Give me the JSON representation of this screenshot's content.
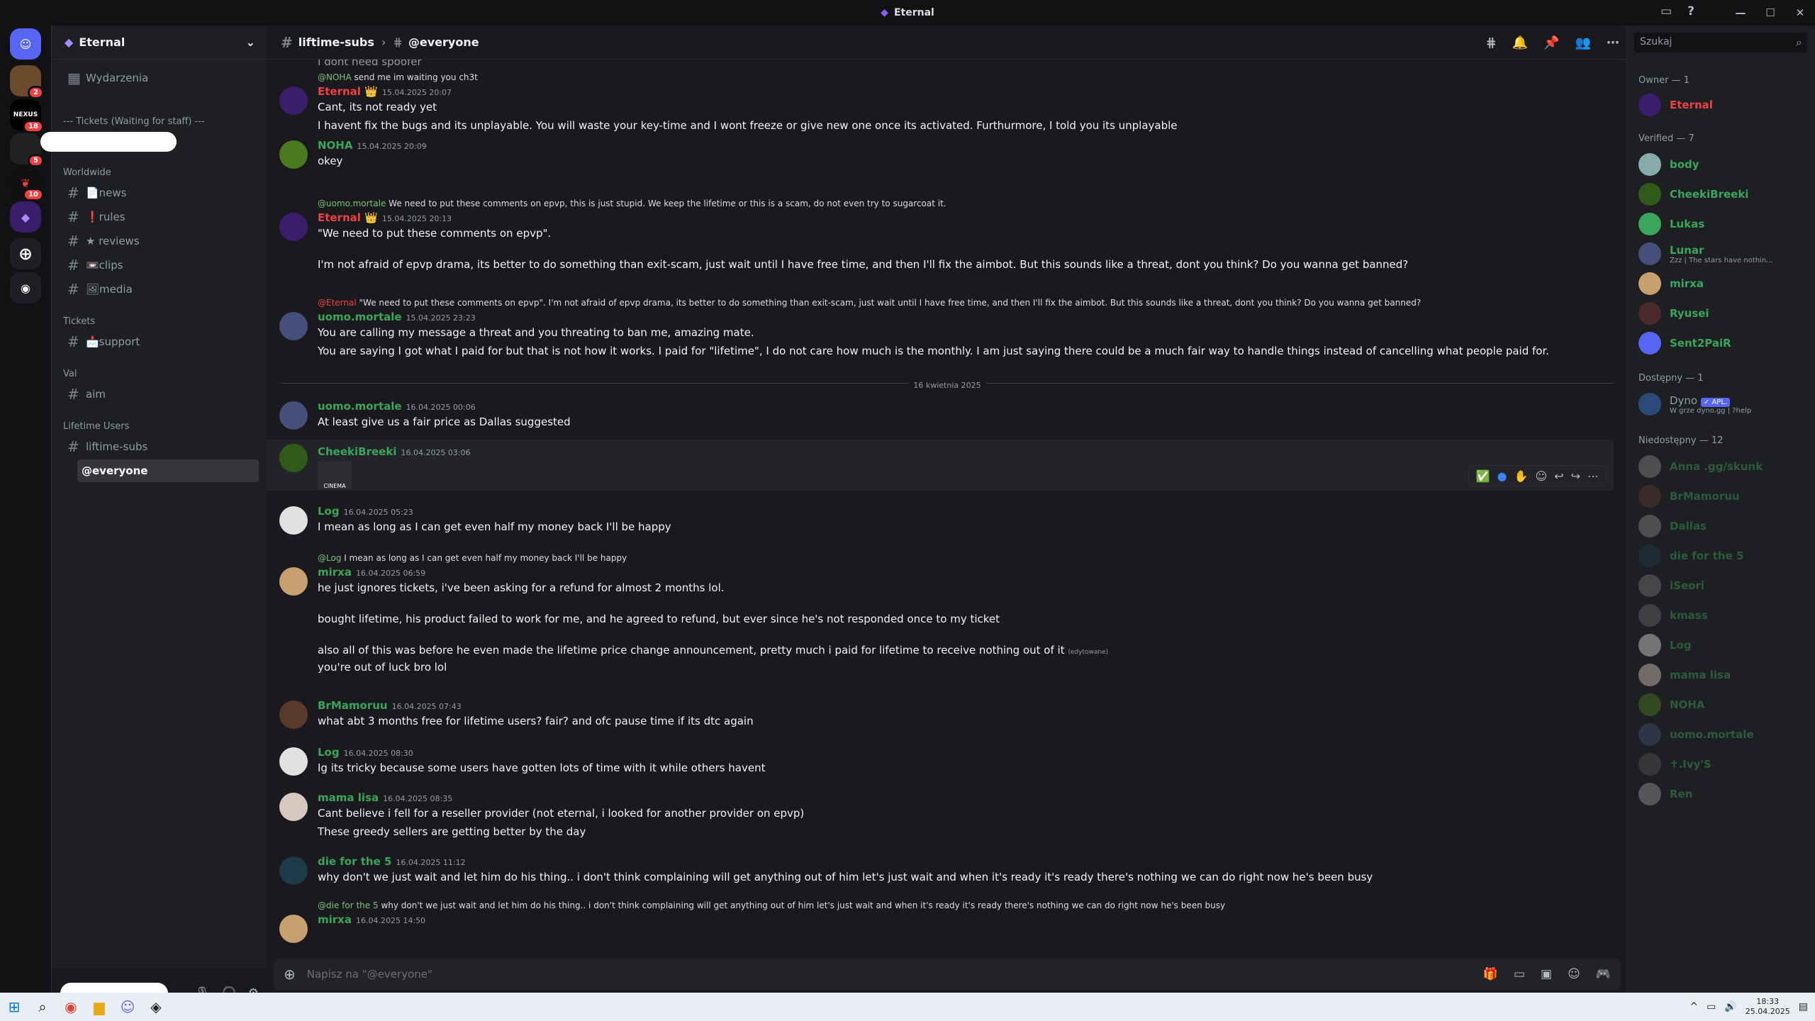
{
  "window": {
    "title": "Eternal",
    "controls": [
      "—",
      "☐",
      "✕"
    ],
    "tray_icons": [
      "▭",
      "?"
    ]
  },
  "server": {
    "name": "Eternal",
    "events": "Wydarzenia",
    "categories": [
      {
        "label": "--- Tickets (Waiting for staff) ---"
      },
      {
        "label": "Worldwide"
      },
      {
        "label": "Tickets"
      },
      {
        "label": "Val"
      },
      {
        "label": "Lifetime Users"
      }
    ],
    "channels": [
      {
        "label": "📄news"
      },
      {
        "label": "❗rules"
      },
      {
        "label": "★ reviews"
      },
      {
        "label": "📼clips"
      },
      {
        "label": "🖼media"
      },
      {
        "label": "📩support"
      },
      {
        "label": "aim"
      },
      {
        "label": "liftime-subs"
      },
      {
        "label": "@everyone"
      }
    ]
  },
  "server_badges": [
    "2",
    "18",
    "5",
    "10"
  ],
  "server_labels": {
    "nexus": "NEXUS"
  },
  "header": {
    "channel": "liftime-subs",
    "thread": "@everyone"
  },
  "colors": {
    "green": "#43b581",
    "red": "#f04747",
    "accent": "#5865f2",
    "name_red": "#ed4245",
    "name_green": "#3ba55c"
  },
  "messages": [
    {
      "reply": "@NOHA",
      "reply_text": "send me im waiting you ch3t",
      "name": "Eternal",
      "time": "15.04.2025 20:07",
      "lines": [
        "Cant, its not ready yet",
        "I havent fix the bugs and its unplayable. You will waste your key-time and I wont freeze or give new one once its activated. Furthurmore, I told you its unplayable"
      ]
    },
    {
      "name": "NOHA",
      "time": "15.04.2025 20:09",
      "lines": [
        "okey"
      ]
    },
    {
      "reply": "@uomo.mortale",
      "reply_text": "We need to put these comments on epvp, this is just stupid. We keep the lifetime or this is a scam, do not even try to sugarcoat it.",
      "name": "Eternal",
      "time": "15.04.2025 20:13",
      "lines": [
        "\"We need to put these comments on epvp\".",
        "I'm not afraid of epvp drama, its better to do something than exit-scam, just wait until I have free time, and then I'll fix the aimbot. But this sounds like a threat, dont you think? Do you wanna get banned?"
      ]
    },
    {
      "reply": "@Eternal",
      "reply_text": "\"We need to put these comments on epvp\".  I'm not afraid of epvp drama, its better to do something than exit-scam, just wait until I have free time, and then I'll fix the aimbot. But this sounds like a threat, dont you think? Do you wanna get banned?",
      "name": "uomo.mortale",
      "time": "15.04.2025 23:23",
      "lines": [
        "You are calling my message a threat and you threating to ban me, amazing mate.",
        "You are saying I got what I paid for but that is not how it works. I paid for \"lifetime\", I do not care how much is the monthly. I am just saying there could be a much fair way to handle things instead of cancelling what people paid for."
      ]
    },
    {
      "name": "uomo.mortale",
      "time": "16.04.2025 00:06",
      "lines": [
        "At least give us a fair price as Dallas suggested"
      ]
    },
    {
      "name": "CheekiBreeki",
      "time": "16.04.2025 03:06",
      "lines": [],
      "image_label": "CINEMA"
    },
    {
      "name": "Log",
      "time": "16.04.2025 05:23",
      "lines": [
        "I mean as long as I can get even half my money back I'll be happy"
      ]
    },
    {
      "reply": "@Log",
      "reply_text": "I mean as long as I can get even half my money back I'll be happy",
      "name": "mirxa",
      "time": "16.04.2025 06:59",
      "lines": [
        "he just ignores tickets, i've been asking for a refund for almost 2 months lol.",
        "bought lifetime, his product failed to work for me, and he agreed to refund, but ever since he's not responded once to my ticket",
        "also all of this was before he even made the lifetime price change announcement, pretty much i paid for lifetime to receive nothing out of it",
        "you're out of luck bro lol"
      ],
      "edited": "(edytowane)"
    },
    {
      "name": "BrMamoruu",
      "time": "16.04.2025 07:43",
      "lines": [
        "what abt 3 months free for lifetime users? fair? and ofc pause time if its dtc again"
      ]
    },
    {
      "name": "Log",
      "time": "16.04.2025 08:30",
      "lines": [
        "Ig its tricky because some users have gotten lots of time with it while others havent"
      ]
    },
    {
      "name": "mama lisa",
      "time": "16.04.2025 08:35",
      "lines": [
        "Cant believe i fell for a reseller provider (not eternal, i looked for another provider on epvp)",
        "These greedy sellers are getting better by the day"
      ]
    },
    {
      "name": "die for the 5",
      "time": "16.04.2025 11:12",
      "lines": [
        "why don't we just wait and let him do his thing.. i don't think complaining will get anything out of him let's just wait and when it's ready it's ready there's nothing we can do right now he's been busy"
      ]
    },
    {
      "reply": "@die for the 5",
      "reply_text": "why don't we just wait and let him do his thing.. i don't think complaining will get anything out of him let's just wait and when it's ready it's ready there's nothing we can do right now he's been busy",
      "name": "mirxa",
      "time": "16.04.2025 14:50",
      "lines": []
    }
  ],
  "top_partial": "I dont need spoofer",
  "date_divider": "16 kwietnia 2025",
  "composer": {
    "placeholder": "Napisz na \"@everyone\""
  },
  "members": {
    "search": "Szukaj",
    "groups": [
      {
        "label": "Owner — 1"
      },
      {
        "label": "Verified — 7"
      },
      {
        "label": "Dostępny — 1"
      },
      {
        "label": "Niedostępny — 12"
      }
    ],
    "list": [
      {
        "name": "Eternal"
      },
      {
        "name": "body"
      },
      {
        "name": "CheekiBreeki"
      },
      {
        "name": "Lukas"
      },
      {
        "name": "Lunar",
        "status": "Zzz | The stars have nothin..."
      },
      {
        "name": "mirxa"
      },
      {
        "name": "Ryusei"
      },
      {
        "name": "Sent2PaiR"
      },
      {
        "name": "Dyno",
        "status": "W grze dyno.gg | ?help",
        "tag": "✓ APL."
      },
      {
        "name": "Anna .gg/skunk"
      },
      {
        "name": "BrMamoruu"
      },
      {
        "name": "Dallas"
      },
      {
        "name": "die for the 5"
      },
      {
        "name": "iSeori"
      },
      {
        "name": "kmass"
      },
      {
        "name": "Log"
      },
      {
        "name": "mama lisa"
      },
      {
        "name": "NOHA"
      },
      {
        "name": "uomo.mortale"
      },
      {
        "name": "✝.Ivy'S"
      },
      {
        "name": "Ren"
      }
    ]
  },
  "clock": {
    "time": "18:33",
    "date": "25.04.2025"
  }
}
